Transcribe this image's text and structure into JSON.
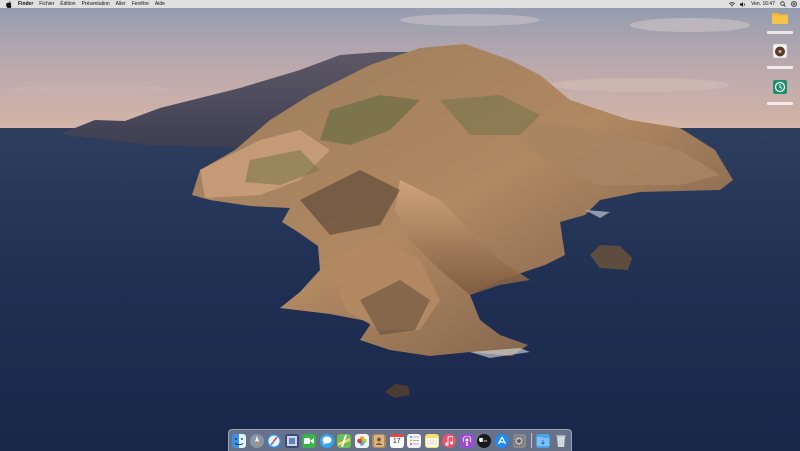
{
  "menubar": {
    "apple_icon": "apple-logo-icon",
    "app_name": "Finder",
    "menus": [
      "Fichier",
      "Édition",
      "Présentation",
      "Aller",
      "Fenêtre",
      "Aide"
    ],
    "status_icons": [
      "wifi-icon",
      "volume-icon"
    ],
    "clock": "Ven. 16:47",
    "right_icons": [
      "search-icon",
      "control-center-icon"
    ]
  },
  "desktop": {
    "icons": [
      {
        "name": "folder-icon",
        "color": "#f3b531"
      },
      {
        "name": "disk-image-icon",
        "color": "#f0f0f0"
      },
      {
        "name": "time-machine-icon",
        "color": "#1e8e6e"
      }
    ]
  },
  "dock": {
    "apps": [
      {
        "name": "finder-icon",
        "color": "#3d8fe6"
      },
      {
        "name": "launchpad-icon",
        "color": "#8a95a5"
      },
      {
        "name": "safari-icon",
        "color": "#2f8fe8"
      },
      {
        "name": "photo-booth-icon",
        "color": "#3b4a78"
      },
      {
        "name": "facetime-icon",
        "color": "#38b44a"
      },
      {
        "name": "messages-icon",
        "color": "#2fa7f2"
      },
      {
        "name": "maps-icon",
        "color": "#6cbf54"
      },
      {
        "name": "photos-icon",
        "color": "#f4f4f4"
      },
      {
        "name": "contacts-icon",
        "color": "#b48a55"
      },
      {
        "name": "calendar-icon",
        "color": "#ffffff"
      },
      {
        "name": "reminders-icon",
        "color": "#f6f6f6"
      },
      {
        "name": "notes-icon",
        "color": "#f8e16c"
      },
      {
        "name": "music-icon",
        "color": "#f0506a"
      },
      {
        "name": "podcasts-icon",
        "color": "#9b4bd7"
      },
      {
        "name": "apple-tv-icon",
        "color": "#1a1a1a"
      },
      {
        "name": "app-store-icon",
        "color": "#1f8bf0"
      },
      {
        "name": "system-preferences-icon",
        "color": "#8a8a8a"
      },
      {
        "name": "downloads-folder-icon",
        "color": "#4aa3e8"
      },
      {
        "name": "trash-icon",
        "color": "#dfe3e8"
      }
    ],
    "calendar_day": "17"
  }
}
